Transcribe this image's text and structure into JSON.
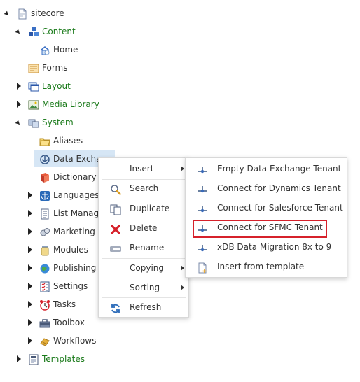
{
  "tree": {
    "items": [
      {
        "label": "sitecore",
        "icon": "document-icon"
      },
      {
        "label": "Content",
        "icon": "content-cubes-icon"
      },
      {
        "label": "Home",
        "icon": "home-icon"
      },
      {
        "label": "Forms",
        "icon": "forms-icon"
      },
      {
        "label": "Layout",
        "icon": "layout-icon"
      },
      {
        "label": "Media Library",
        "icon": "media-library-icon"
      },
      {
        "label": "System",
        "icon": "system-icon"
      },
      {
        "label": "Aliases",
        "icon": "folder-icon"
      },
      {
        "label": "Data Exchange",
        "icon": "data-exchange-icon"
      },
      {
        "label": "Dictionary",
        "icon": "dictionary-book-icon"
      },
      {
        "label": "Languages",
        "icon": "globe-icon"
      },
      {
        "label": "List Manager",
        "icon": "list-manager-icon"
      },
      {
        "label": "Marketing Control Panel",
        "icon": "marketing-icon"
      },
      {
        "label": "Modules",
        "icon": "modules-jar-icon"
      },
      {
        "label": "Publishing targets",
        "icon": "publishing-globe-icon"
      },
      {
        "label": "Settings",
        "icon": "settings-checklist-icon"
      },
      {
        "label": "Tasks",
        "icon": "tasks-clock-icon"
      },
      {
        "label": "Toolbox",
        "icon": "toolbox-icon"
      },
      {
        "label": "Workflows",
        "icon": "workflows-icon"
      },
      {
        "label": "Templates",
        "icon": "templates-icon"
      }
    ]
  },
  "context_menu": {
    "items": [
      {
        "label": "Insert",
        "icon": "",
        "has_submenu": true
      },
      {
        "label": "Search",
        "icon": "search-icon",
        "has_submenu": false
      },
      {
        "label": "Duplicate",
        "icon": "duplicate-icon",
        "has_submenu": false
      },
      {
        "label": "Delete",
        "icon": "delete-x-icon",
        "has_submenu": false
      },
      {
        "label": "Rename",
        "icon": "rename-icon",
        "has_submenu": false
      },
      {
        "label": "Copying",
        "icon": "",
        "has_submenu": true
      },
      {
        "label": "Sorting",
        "icon": "",
        "has_submenu": true
      },
      {
        "label": "Refresh",
        "icon": "refresh-icon",
        "has_submenu": false
      }
    ]
  },
  "insert_submenu": {
    "items": [
      {
        "label": "Empty Data Exchange Tenant",
        "icon": "tenant-icon"
      },
      {
        "label": "Connect for Dynamics Tenant",
        "icon": "tenant-icon"
      },
      {
        "label": "Connect for Salesforce Tenant",
        "icon": "tenant-icon"
      },
      {
        "label": "Connect for SFMC Tenant",
        "icon": "tenant-icon",
        "highlighted": true
      },
      {
        "label": "xDB Data Migration 8x to 9",
        "icon": "tenant-icon"
      },
      {
        "label": "Insert from template",
        "icon": "insert-from-template-icon"
      }
    ]
  },
  "colors": {
    "accent_green": "#1a7a1a",
    "selection_bg": "#d6e6f5",
    "highlight_border": "#d6212b",
    "delete_red": "#d6212b"
  }
}
